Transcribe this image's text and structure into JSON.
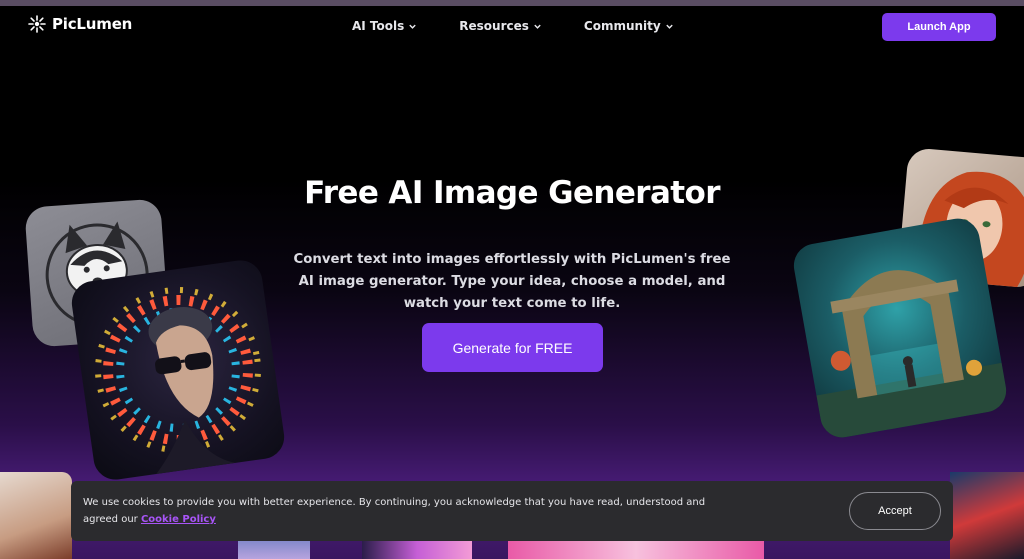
{
  "brand": {
    "name": "PicLumen"
  },
  "nav": {
    "items": [
      {
        "label": "AI Tools"
      },
      {
        "label": "Resources"
      },
      {
        "label": "Community"
      }
    ],
    "launch_label": "Launch App"
  },
  "hero": {
    "title": "Free AI Image Generator",
    "subtitle": "Convert text into images effortlessly with PicLumen's free AI image generator. Type your idea, choose a model, and watch your text come to life.",
    "cta_label": "Generate for FREE"
  },
  "cookie": {
    "text": "We use cookies to provide you with better experience. By continuing, you acknowledge that you have read, understood and agreed our ",
    "link": "Cookie Policy",
    "accept_label": "Accept"
  },
  "colors": {
    "accent": "#7c3aed",
    "link": "#a855f7",
    "banner_bg": "#2b2b2e"
  },
  "icons": [
    "piclumen-logo-icon",
    "chevron-down-icon"
  ]
}
